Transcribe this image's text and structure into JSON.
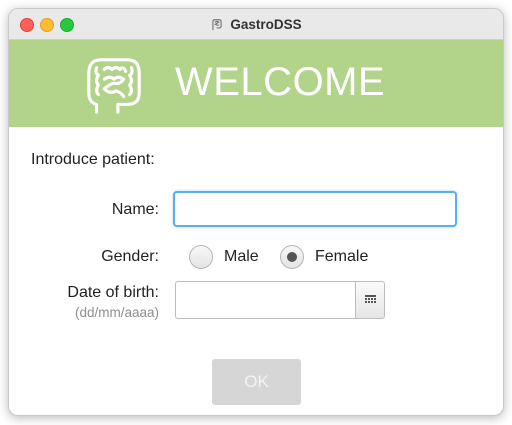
{
  "window": {
    "title": "GastroDSS"
  },
  "banner": {
    "heading": "WELCOME",
    "logo_icon": "intestine-icon",
    "color": "#b2d38a"
  },
  "form": {
    "intro": "Introduce patient:",
    "name_label": "Name:",
    "name_value": "",
    "gender_label": "Gender:",
    "gender_options": [
      "Male",
      "Female"
    ],
    "gender_selected": "Female",
    "dob_label": "Date of birth:",
    "dob_hint": "(dd/mm/aaaa)",
    "dob_value": "",
    "calendar_icon": "calendar-icon",
    "ok_label": "OK",
    "accent_color": "#5ab0ee"
  }
}
